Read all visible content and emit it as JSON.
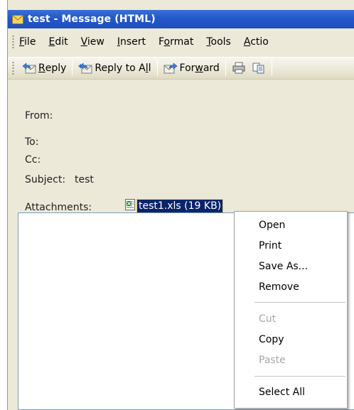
{
  "window": {
    "title": "test - Message (HTML)"
  },
  "menu": [
    {
      "pre": "",
      "ul": "F",
      "post": "ile"
    },
    {
      "pre": "",
      "ul": "E",
      "post": "dit"
    },
    {
      "pre": "",
      "ul": "V",
      "post": "iew"
    },
    {
      "pre": "",
      "ul": "I",
      "post": "nsert"
    },
    {
      "pre": "F",
      "ul": "o",
      "post": "rmat"
    },
    {
      "pre": "",
      "ul": "T",
      "post": "ools"
    },
    {
      "pre": "",
      "ul": "A",
      "post": "ctio"
    }
  ],
  "toolbar": {
    "reply_pre": "",
    "reply_ul": "R",
    "reply_post": "eply",
    "reply_all_pre": "Reply to A",
    "reply_all_ul": "l",
    "reply_all_post": "l",
    "forward_pre": "For",
    "forward_ul": "w",
    "forward_post": "ard"
  },
  "header": {
    "from_label": "From:",
    "to_label": "To:",
    "cc_label": "Cc:",
    "subject_label": "Subject:",
    "subject_value": "test",
    "attachments_label": "Attachments:",
    "attachment_name": "test1.xls (19 KB)"
  },
  "context_menu": {
    "items": [
      {
        "label": "Open",
        "enabled": true
      },
      {
        "label": "Print",
        "enabled": true
      },
      {
        "label": "Save As...",
        "enabled": true
      },
      {
        "label": "Remove",
        "enabled": true
      },
      {
        "label": "Cut",
        "enabled": false
      },
      {
        "label": "Copy",
        "enabled": true
      },
      {
        "label": "Paste",
        "enabled": false
      },
      {
        "label": "Select All",
        "enabled": true
      }
    ]
  },
  "colors": {
    "title_bar": "#2457c8",
    "selection": "#0a246a",
    "chrome": "#ece9d8"
  },
  "icons": [
    "envelope-icon",
    "reply-icon",
    "reply-all-icon",
    "forward-icon",
    "print-icon",
    "copy-icon",
    "excel-file-icon"
  ]
}
